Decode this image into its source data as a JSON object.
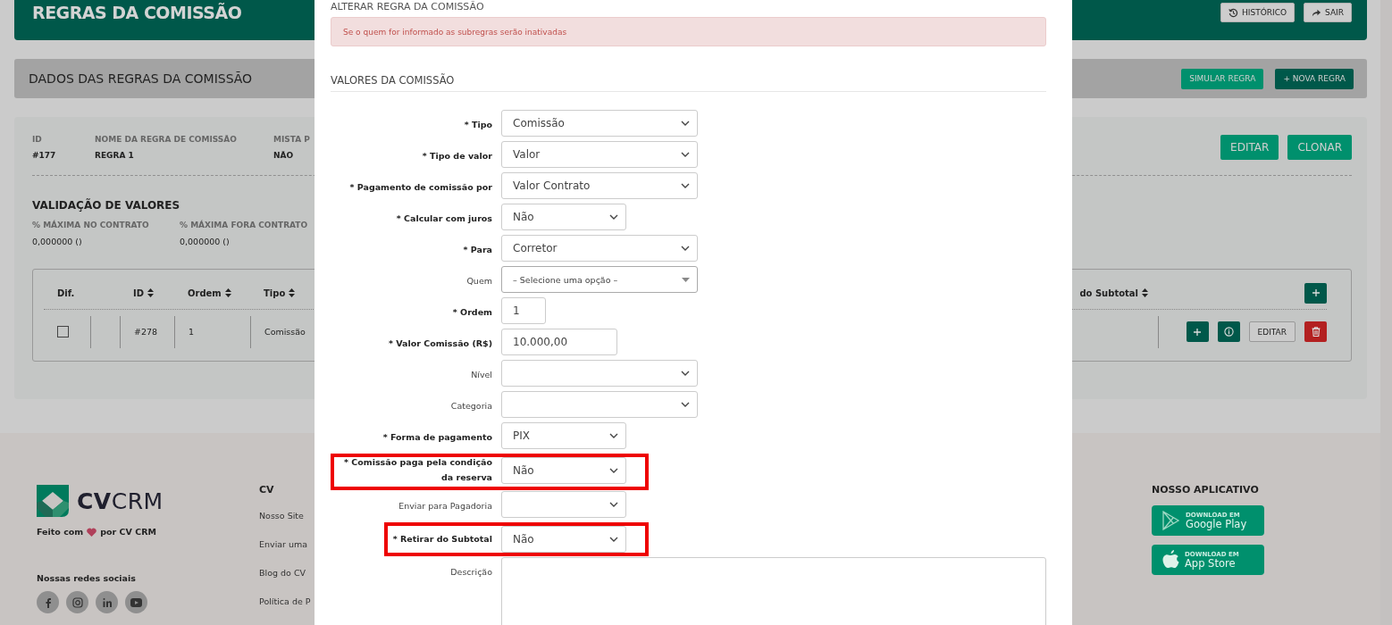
{
  "header": {
    "title": "REGRAS DA COMISSÃO",
    "buttons": [
      "HISTÓRICO",
      "SAIR"
    ]
  },
  "section_bar": {
    "title": "DADOS DAS REGRAS DA COMISSÃO",
    "buttons": [
      {
        "label": "SIMULAR REGRA",
        "kind": "primary"
      },
      {
        "label": "+ NOVA REGRA",
        "kind": "dark"
      }
    ]
  },
  "rule": {
    "fields": [
      {
        "label": "ID",
        "value": "#177"
      },
      {
        "label": "NOME DA REGRA DE COMISSÃO",
        "value": "REGRA 1"
      },
      {
        "label": "MISTA P",
        "value": "NÃO"
      }
    ],
    "buttons": [
      "EDITAR",
      "CLONAR"
    ],
    "validation": {
      "title": "VALIDAÇÃO DE VALORES",
      "fields": [
        {
          "label": "% MÁXIMA NO CONTRATO",
          "value": "0,000000 ()"
        },
        {
          "label": "% MÁXIMA FORA CONTRATO",
          "value": "0,000000 ()"
        }
      ]
    }
  },
  "table": {
    "columns": [
      {
        "label": "Dif.",
        "sortable": false
      },
      {
        "kind": "spacer"
      },
      {
        "label": "ID",
        "sortable": true
      },
      {
        "label": "Ordem",
        "sortable": true
      },
      {
        "label": "Tipo",
        "sortable": true
      }
    ],
    "right_column": "do Subtotal",
    "rows": [
      {
        "cells": [
          {
            "kind": "checkbox",
            "checked": false
          },
          {
            "kind": "empty"
          },
          {
            "kind": "text",
            "text": "#278"
          },
          {
            "kind": "text",
            "text": "1"
          },
          {
            "kind": "text",
            "text": "Comissão"
          }
        ],
        "actions": [
          {
            "kind": "add"
          },
          {
            "kind": "info"
          },
          {
            "kind": "edit",
            "label": "EDITAR"
          },
          {
            "kind": "delete"
          }
        ]
      }
    ]
  },
  "footer": {
    "logo": "**CV**CRM",
    "tagline_before": "Feito com",
    "tagline_after": "por CV CRM",
    "social_title": "Nossas redes sociais",
    "column_title": "CV",
    "links": [
      "Nosso Site",
      "Enviar uma",
      "Blog do CV",
      "Política de P"
    ],
    "app_title": "NOSSO APLICATIVO",
    "stores": [
      {
        "kind": "google",
        "small": "DOWNLOAD EM",
        "name": "Google Play"
      },
      {
        "kind": "apple",
        "small": "DOWNLOAD EM",
        "name": "App Store"
      }
    ]
  },
  "modal": {
    "title": "ALTERAR REGRA DA COMISSÃO",
    "alert": "Se o quem for informado as subregras serão inativadas",
    "section": "VALORES DA COMISSÃO",
    "fields": [
      {
        "label": "* Tipo",
        "kind": "select",
        "value": "Comissão",
        "highlighted": false
      },
      {
        "label": "* Tipo de valor",
        "kind": "select",
        "value": "Valor",
        "highlighted": false
      },
      {
        "label": "* Pagamento de comissão por",
        "kind": "select",
        "value": "Valor Contrato",
        "highlighted": false
      },
      {
        "label": "* Calcular com juros",
        "kind": "select",
        "value": "Não",
        "highlighted": false
      },
      {
        "label": "* Para",
        "kind": "select",
        "value": "Corretor",
        "highlighted": false
      },
      {
        "label": "Quem",
        "kind": "select2",
        "value": "– Selecione uma opção –",
        "highlighted": false
      },
      {
        "label": "* Ordem",
        "kind": "input",
        "value": "1",
        "highlighted": false
      },
      {
        "label": "* Valor Comissão (R$)",
        "kind": "input",
        "value": "10.000,00",
        "highlighted": false
      },
      {
        "label": "Nível",
        "kind": "select",
        "highlighted": false
      },
      {
        "label": "Categoria",
        "kind": "select",
        "highlighted": false
      },
      {
        "label": "* Forma de pagamento",
        "kind": "select",
        "value": "PIX",
        "highlighted": false
      },
      {
        "label": "* Comissão paga pela condição da reserva",
        "kind": "select",
        "value": "Não",
        "highlighted": true
      },
      {
        "label": "Enviar para Pagadoria",
        "kind": "select",
        "highlighted": false
      },
      {
        "label": "* Retirar do Subtotal",
        "kind": "select",
        "value": "Não",
        "highlighted": true
      },
      {
        "label": "Descrição",
        "kind": "textarea",
        "highlighted": false
      }
    ]
  }
}
